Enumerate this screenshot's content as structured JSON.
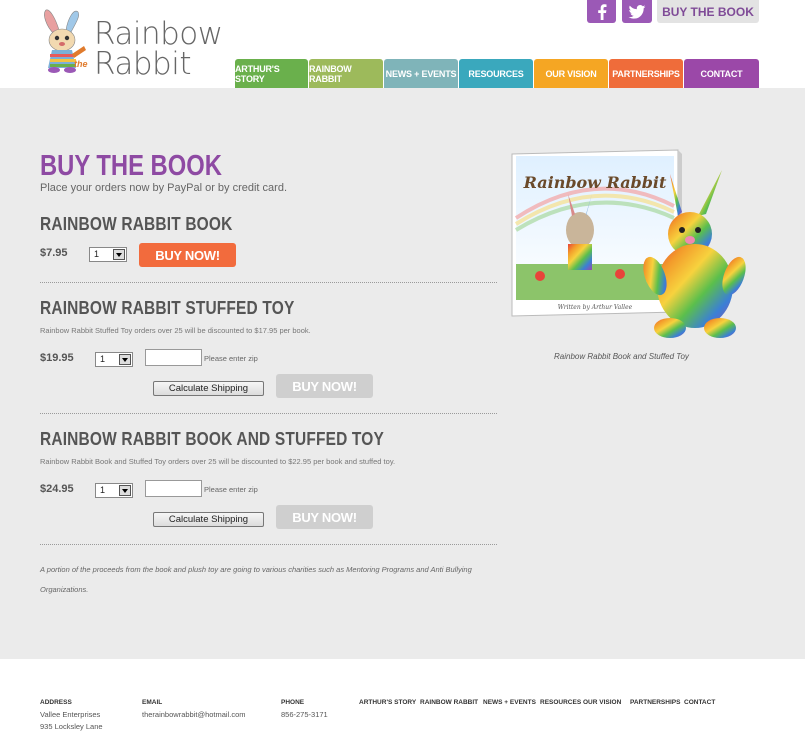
{
  "logo": {
    "word1": "Rainbow",
    "the": "the",
    "word2": "Rabbit"
  },
  "social": {
    "facebook": "f",
    "buy_the_book": "BUY THE BOOK"
  },
  "nav": [
    {
      "label": "ARTHUR'S STORY",
      "color": "#6ab04c"
    },
    {
      "label": "RAINBOW RABBIT",
      "color": "#9dba5b"
    },
    {
      "label": "NEWS + EVENTS",
      "color": "#7fb4b9"
    },
    {
      "label": "RESOURCES",
      "color": "#3aa8bd"
    },
    {
      "label": "OUR VISION",
      "color": "#f5a623"
    },
    {
      "label": "PARTNERSHIPS",
      "color": "#ef6c3a"
    },
    {
      "label": "CONTACT",
      "color": "#9b48a8"
    }
  ],
  "page": {
    "title": "BUY THE BOOK",
    "subtitle": "Place your orders now by PayPal or by credit card."
  },
  "products": [
    {
      "title": "RAINBOW RABBIT BOOK",
      "price": "$7.95",
      "qty": "1",
      "buy_label": "BUY NOW!"
    },
    {
      "title": "RAINBOW RABBIT STUFFED TOY",
      "desc": "Rainbow Rabbit Stuffed Toy orders over 25 will be discounted to $17.95 per book.",
      "price": "$19.95",
      "qty": "1",
      "zip_hint": "Please enter zip",
      "calc_label": "Calculate Shipping",
      "buy_label": "BUY NOW!"
    },
    {
      "title": "RAINBOW RABBIT BOOK AND STUFFED TOY",
      "desc": "Rainbow Rabbit Book and Stuffed Toy orders over 25 will be discounted to $22.95 per book and stuffed toy.",
      "price": "$24.95",
      "qty": "1",
      "zip_hint": "Please enter zip",
      "calc_label": "Calculate Shipping",
      "buy_label": "BUY NOW!"
    }
  ],
  "note": "A portion of the proceeds from the book and plush toy are going to various charities such as Mentoring Programs and Anti Bullying Organizations.",
  "product_image": {
    "cover_title": "Rainbow Rabbit",
    "cover_author": "Written by Arthur Vallee",
    "caption": "Rainbow Rabbit Book and Stuffed Toy"
  },
  "footer": {
    "address_label": "ADDRESS",
    "address_line1": "Vallee Enterprises",
    "address_line2": "935 Locksley Lane",
    "email_label": "EMAIL",
    "email": "therainbowrabbit@hotmail.com",
    "phone_label": "PHONE",
    "phone": "856-275-3171",
    "nav": [
      "ARTHUR'S STORY",
      "RAINBOW RABBIT",
      "NEWS + EVENTS",
      "RESOURCES",
      "OUR VISION",
      "PARTNERSHIPS",
      "CONTACT"
    ]
  }
}
